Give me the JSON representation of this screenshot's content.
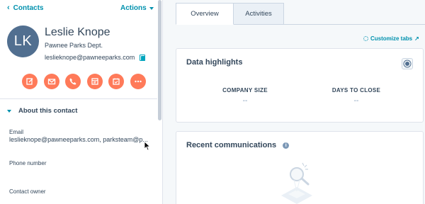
{
  "sidebar": {
    "back_label": "Contacts",
    "actions_label": "Actions",
    "contact": {
      "initials": "LK",
      "name": "Leslie Knope",
      "company": "Pawnee Parks Dept.",
      "email": "leslieknope@pawneeparks.com"
    },
    "quick_actions": [
      "note",
      "email",
      "call",
      "log",
      "task",
      "more"
    ],
    "about_section": {
      "title": "About this contact",
      "fields": [
        {
          "label": "Email",
          "value": "leslieknope@pawneeparks.com, parksteam@p..."
        },
        {
          "label": "Phone number",
          "value": ""
        },
        {
          "label": "Contact owner",
          "value": ""
        }
      ]
    }
  },
  "tabs": [
    {
      "label": "Overview",
      "active": true
    },
    {
      "label": "Activities",
      "active": false
    }
  ],
  "customize_label": "Customize tabs",
  "data_highlights": {
    "title": "Data highlights",
    "stats": [
      {
        "label": "COMPANY SIZE",
        "value": "--"
      },
      {
        "label": "DAYS TO CLOSE",
        "value": "--"
      }
    ]
  },
  "recent_communications": {
    "title": "Recent communications"
  },
  "colors": {
    "accent": "#0091ae",
    "action_orange": "#ff7a59",
    "avatar": "#516f90"
  }
}
